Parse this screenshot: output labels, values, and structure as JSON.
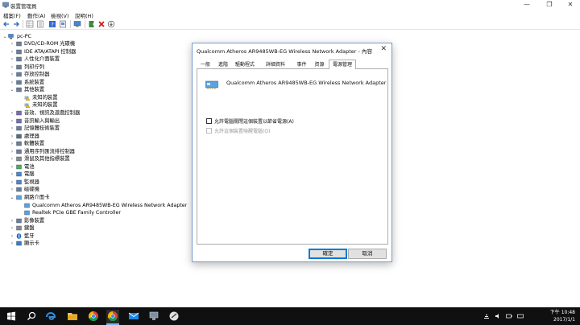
{
  "window": {
    "title": "裝置管理員",
    "min_glyph": "—",
    "max_glyph": "❐",
    "close_glyph": "✕"
  },
  "menu": [
    "檔案(F)",
    "動作(A)",
    "檢視(V)",
    "說明(H)"
  ],
  "toolbar": {
    "buttons": [
      "back-icon",
      "forward-icon",
      "properties-grid-icon",
      "device-list-icon",
      "help-icon",
      "device-view-icon",
      "monitor-icon",
      "update-driver-icon",
      "uninstall-icon",
      "download-icon"
    ]
  },
  "tree": {
    "root": "pc-PC",
    "items": [
      {
        "label": "DVD/CD-ROM 光碟機",
        "expander": "›",
        "icon": "dvd-icon"
      },
      {
        "label": "IDE ATA/ATAPI 控制器",
        "expander": "›",
        "icon": "ide-controller-icon"
      },
      {
        "label": "人性化介面裝置",
        "expander": "›",
        "icon": "hid-icon"
      },
      {
        "label": "列印佇列",
        "expander": "›",
        "icon": "print-queue-icon"
      },
      {
        "label": "存放控制器",
        "expander": "›",
        "icon": "storage-controller-icon"
      },
      {
        "label": "系統裝置",
        "expander": "›",
        "icon": "system-device-icon"
      },
      {
        "label": "其他裝置",
        "expander": "⌄",
        "icon": "other-device-icon"
      },
      {
        "label": "未知的裝置",
        "expander": "",
        "icon": "unknown-device-warning-icon",
        "child": true
      },
      {
        "label": "未知的裝置",
        "expander": "",
        "icon": "unknown-device-warning-icon",
        "child": true
      },
      {
        "label": "音效、視訊及遊戲控制器",
        "expander": "›",
        "icon": "sound-icon"
      },
      {
        "label": "音訊輸入與輸出",
        "expander": "›",
        "icon": "audio-io-icon"
      },
      {
        "label": "記憶體技術裝置",
        "expander": "›",
        "icon": "memory-device-icon"
      },
      {
        "label": "處理器",
        "expander": "›",
        "icon": "processor-icon"
      },
      {
        "label": "軟體裝置",
        "expander": "›",
        "icon": "software-device-icon"
      },
      {
        "label": "通用序列匯流排控制器",
        "expander": "›",
        "icon": "usb-icon"
      },
      {
        "label": "滑鼠及其他指標裝置",
        "expander": "›",
        "icon": "mouse-icon"
      },
      {
        "label": "電池",
        "expander": "›",
        "icon": "battery-icon"
      },
      {
        "label": "電腦",
        "expander": "›",
        "icon": "computer-icon"
      },
      {
        "label": "監視器",
        "expander": "›",
        "icon": "monitor-icon"
      },
      {
        "label": "磁碟機",
        "expander": "›",
        "icon": "disk-drive-icon"
      },
      {
        "label": "網路介面卡",
        "expander": "⌄",
        "icon": "network-adapter-icon"
      },
      {
        "label": "Qualcomm Atheros AR9485WB-EG Wireless Network Adapter",
        "expander": "",
        "icon": "network-adapter-icon",
        "child": true
      },
      {
        "label": "Realtek PCIe GBE Family Controller",
        "expander": "",
        "icon": "network-adapter-icon",
        "child": true
      },
      {
        "label": "影像裝置",
        "expander": "›",
        "icon": "imaging-device-icon"
      },
      {
        "label": "鍵盤",
        "expander": "›",
        "icon": "keyboard-icon"
      },
      {
        "label": "藍牙",
        "expander": "›",
        "icon": "bluetooth-icon"
      },
      {
        "label": "顯示卡",
        "expander": "›",
        "icon": "display-adapter-icon"
      }
    ]
  },
  "dialog": {
    "title": "Qualcomm Atheros AR9485WB-EG Wireless Network Adapter - 內容",
    "close_glyph": "✕",
    "tabs": [
      "一般",
      "進階",
      "驅動程式",
      "詳細資料",
      "事件",
      "資源",
      "電源管理"
    ],
    "active_tab": "電源管理",
    "device_name": "Qualcomm Atheros AR9485WB-EG Wireless Network Adapter",
    "options": [
      {
        "label": "允許電腦關閉這個裝置以節省電源(A)",
        "checked": false,
        "enabled": true
      },
      {
        "label": "允許這個裝置喚醒電腦(O)",
        "checked": false,
        "enabled": false
      }
    ],
    "ok_label": "確定",
    "cancel_label": "取消"
  },
  "taskbar": {
    "apps": [
      "start-icon",
      "search-icon",
      "edge-icon",
      "file-explorer-icon",
      "chrome-icon",
      "chrome-icon",
      "mail-icon",
      "device-manager-icon",
      "app-icon"
    ],
    "tray": [
      "network-icon",
      "volume-icon",
      "battery-icon",
      "keyboard-icon"
    ],
    "time": "下午 10:48",
    "date": "2017/1/1"
  },
  "colors": {
    "accent": "#0078d7",
    "warning": "#f0c000",
    "taskbar": "#101010",
    "dialog_border": "#7a9ccf"
  }
}
